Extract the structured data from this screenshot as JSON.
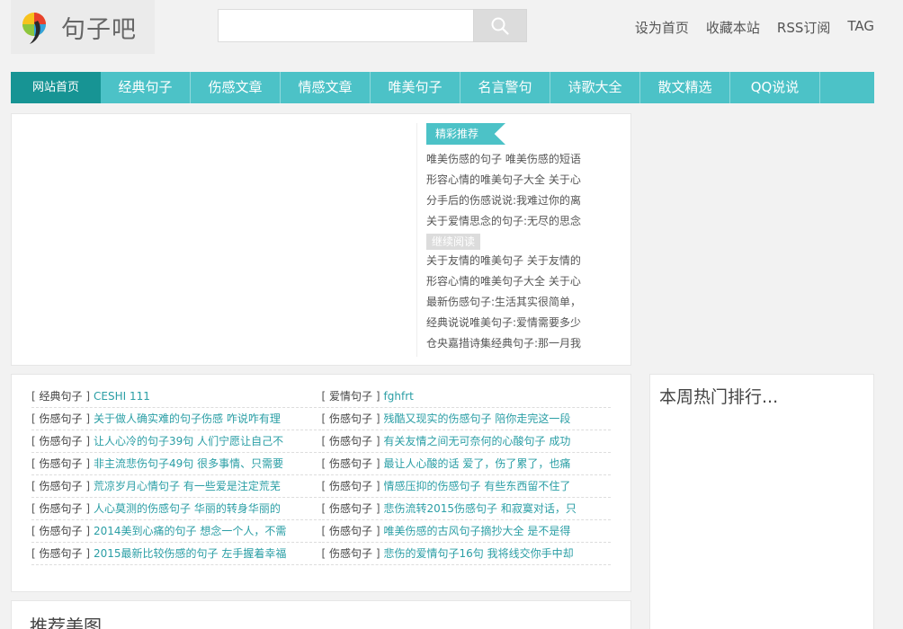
{
  "logo": {
    "text": "句子吧",
    "icon": "rainbow-leaf-logo"
  },
  "search": {
    "placeholder": "",
    "button_icon": "search-icon"
  },
  "toplinks": [
    "设为首页",
    "收藏本站",
    "RSS订阅",
    "TAG"
  ],
  "nav": [
    "网站首页",
    "经典句子",
    "伤感文章",
    "情感文章",
    "唯美句子",
    "名言警句",
    "诗歌大全",
    "散文精选",
    "QQ说说"
  ],
  "recommend": {
    "title": "精彩推荐",
    "items_a": [
      "唯美伤感的句子 唯美伤感的短语",
      "形容心情的唯美句子大全 关于心",
      "分手后的伤感说说:我难过你的离",
      "关于爱情思念的句子:无尽的思念"
    ],
    "more": "继续阅读",
    "items_b": [
      "关于友情的唯美句子 关于友情的",
      "形容心情的唯美句子大全 关于心",
      "最新伤感句子:生活其实很简单，",
      "经典说说唯美句子:爱情需要多少",
      "仓央嘉措诗集经典句子:那一月我"
    ]
  },
  "articles": {
    "left": [
      {
        "cat": "经典句子",
        "title": "CESHI 111"
      },
      {
        "cat": "伤感句子",
        "title": "关于做人确实难的句子伤感 咋说咋有理"
      },
      {
        "cat": "伤感句子",
        "title": "让人心冷的句子39句 人们宁愿让自己不"
      },
      {
        "cat": "伤感句子",
        "title": "非主流悲伤句子49句 很多事情、只需要"
      },
      {
        "cat": "伤感句子",
        "title": "荒凉岁月心情句子 有一些爱是注定荒芜"
      },
      {
        "cat": "伤感句子",
        "title": "人心莫测的伤感句子 华丽的转身华丽的"
      },
      {
        "cat": "伤感句子",
        "title": "2014美到心痛的句子 想念一个人，不需"
      },
      {
        "cat": "伤感句子",
        "title": "2015最新比较伤感的句子 左手握着幸福"
      }
    ],
    "right": [
      {
        "cat": "爱情句子",
        "title": "fghfrt"
      },
      {
        "cat": "伤感句子",
        "title": "残酷又现实的伤感句子 陪你走完这一段"
      },
      {
        "cat": "伤感句子",
        "title": "有关友情之间无可奈何的心酸句子 成功"
      },
      {
        "cat": "伤感句子",
        "title": "最让人心酸的话 爱了，伤了累了，也痛"
      },
      {
        "cat": "伤感句子",
        "title": "情感压抑的伤感句子 有些东西留不住了"
      },
      {
        "cat": "伤感句子",
        "title": "悲伤流转2015伤感句子 和寂寞对话，只"
      },
      {
        "cat": "伤感句子",
        "title": "唯美伤感的古风句子摘抄大全 是不是得"
      },
      {
        "cat": "伤感句子",
        "title": "悲伤的爱情句子16句 我将线交你手中却"
      }
    ]
  },
  "pics": {
    "title": "推荐美图..."
  },
  "hot": {
    "title": "本周热门排行..."
  },
  "colors": {
    "nav": "#4cc2c7",
    "nav_active": "#179494",
    "link": "#2a9ea5"
  }
}
